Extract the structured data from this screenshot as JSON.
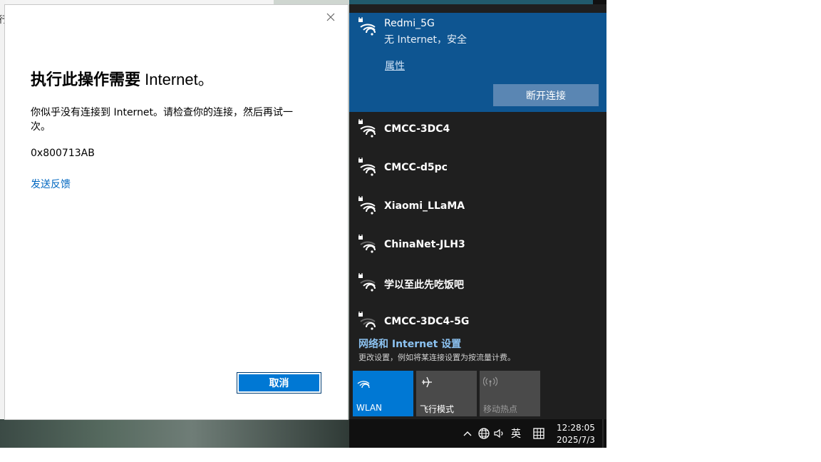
{
  "background_window": {
    "fragment": "行"
  },
  "dialog": {
    "title_cn": "执行此操作需要 ",
    "title_en": "Internet。",
    "message": "你似乎没有连接到 Internet。请检查你的连接，然后再试一次。",
    "error_code": "0x800713AB",
    "feedback_link": "发送反馈",
    "cancel_label": "取消"
  },
  "flyout": {
    "connected": {
      "ssid": "Redmi_5G",
      "status": "无 Internet，安全",
      "properties_link": "属性",
      "disconnect_label": "断开连接"
    },
    "networks": [
      {
        "name": "CMCC-3DC4"
      },
      {
        "name": "CMCC-d5pc"
      },
      {
        "name": "Xiaomi_LLaMA"
      },
      {
        "name": "ChinaNet-JLH3"
      },
      {
        "name": "学以至此先吃饭吧"
      },
      {
        "name": "CMCC-3DC4-5G"
      }
    ],
    "settings_link": "网络和 Internet 设置",
    "settings_desc": "更改设置，例如将某连接设置为按流量计费。",
    "tiles": {
      "wlan": "WLAN",
      "airplane": "飞行模式",
      "hotspot": "移动热点"
    }
  },
  "taskbar": {
    "ime": "英",
    "time": "12:28:05",
    "date": "2025/7/3"
  },
  "colors": {
    "accent": "#0078d4",
    "connected_bg": "#0e5591",
    "flyout_bg": "#1f1f1f"
  }
}
